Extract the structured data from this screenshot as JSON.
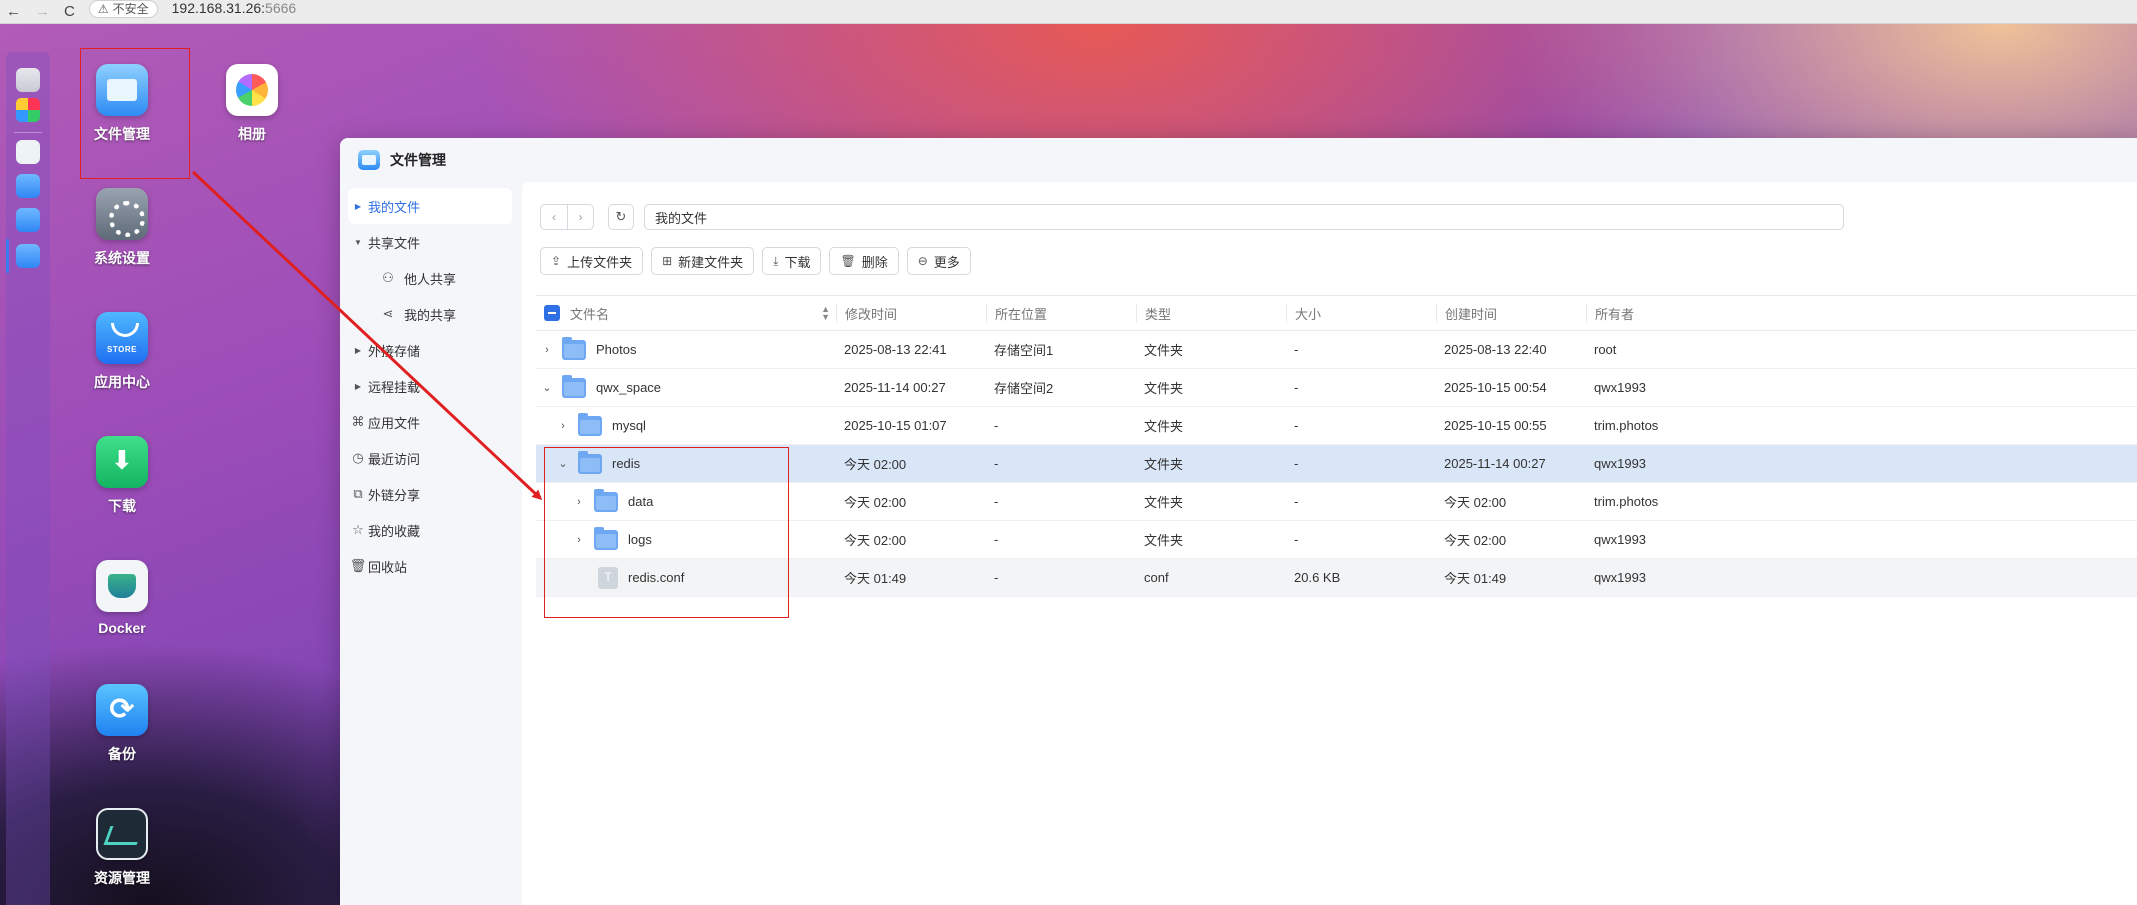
{
  "browser": {
    "back": "←",
    "forward": "→",
    "reload": "C",
    "security": "不安全",
    "address_host": "192.168.31.26:",
    "address_port": "5666"
  },
  "desktop": {
    "icons": [
      {
        "label": "文件管理",
        "icon": "file-manager-icon"
      },
      {
        "label": "相册",
        "icon": "photos-icon"
      },
      {
        "label": "系统设置",
        "icon": "settings-icon"
      },
      {
        "label": "应用中心",
        "icon": "app-store-icon",
        "sub": "STORE"
      },
      {
        "label": "下载",
        "icon": "download-icon"
      },
      {
        "label": "Docker",
        "icon": "docker-icon"
      },
      {
        "label": "备份",
        "icon": "backup-icon"
      },
      {
        "label": "资源管理",
        "icon": "resource-monitor-icon"
      }
    ]
  },
  "window": {
    "title": "文件管理",
    "sidebar": {
      "items": [
        {
          "label": "我的文件",
          "icon": "caret-right-icon"
        },
        {
          "label": "共享文件",
          "icon": "caret-down-icon"
        },
        {
          "label": "他人共享",
          "icon": "users-icon"
        },
        {
          "label": "我的共享",
          "icon": "share-icon"
        },
        {
          "label": "外接存储",
          "icon": "caret-right-icon"
        },
        {
          "label": "远程挂载",
          "icon": "caret-right-icon"
        },
        {
          "label": "应用文件",
          "icon": "grid-icon"
        },
        {
          "label": "最近访问",
          "icon": "clock-icon"
        },
        {
          "label": "外链分享",
          "icon": "external-link-icon"
        },
        {
          "label": "我的收藏",
          "icon": "star-icon"
        },
        {
          "label": "回收站",
          "icon": "trash-icon"
        }
      ]
    },
    "path": "我的文件",
    "toolbar": {
      "upload": "上传文件夹",
      "new_folder": "新建文件夹",
      "download": "下载",
      "delete": "删除",
      "more": "更多"
    },
    "columns": {
      "name": "文件名",
      "mtime": "修改时间",
      "location": "所在位置",
      "type": "类型",
      "size": "大小",
      "ctime": "创建时间",
      "owner": "所有者"
    },
    "rows": [
      {
        "name": "Photos",
        "mtime": "2025-08-13 22:41",
        "location": "存储空间1",
        "type": "文件夹",
        "size": "-",
        "ctime": "2025-08-13 22:40",
        "owner": "root"
      },
      {
        "name": "qwx_space",
        "mtime": "2025-11-14 00:27",
        "location": "存储空间2",
        "type": "文件夹",
        "size": "-",
        "ctime": "2025-10-15 00:54",
        "owner": "qwx1993"
      },
      {
        "name": "mysql",
        "mtime": "2025-10-15 01:07",
        "location": "-",
        "type": "文件夹",
        "size": "-",
        "ctime": "2025-10-15 00:55",
        "owner": "trim.photos"
      },
      {
        "name": "redis",
        "mtime": "今天 02:00",
        "location": "-",
        "type": "文件夹",
        "size": "-",
        "ctime": "2025-11-14 00:27",
        "owner": "qwx1993"
      },
      {
        "name": "data",
        "mtime": "今天 02:00",
        "location": "-",
        "type": "文件夹",
        "size": "-",
        "ctime": "今天 02:00",
        "owner": "trim.photos"
      },
      {
        "name": "logs",
        "mtime": "今天 02:00",
        "location": "-",
        "type": "文件夹",
        "size": "-",
        "ctime": "今天 02:00",
        "owner": "qwx1993"
      },
      {
        "name": "redis.conf",
        "mtime": "今天 01:49",
        "location": "-",
        "type": "conf",
        "size": "20.6 KB",
        "ctime": "今天 01:49",
        "owner": "qwx1993"
      }
    ]
  },
  "colors": {
    "accent": "#2f6fe4",
    "highlight": "#e02020",
    "selected_row": "#d9e6f8"
  }
}
